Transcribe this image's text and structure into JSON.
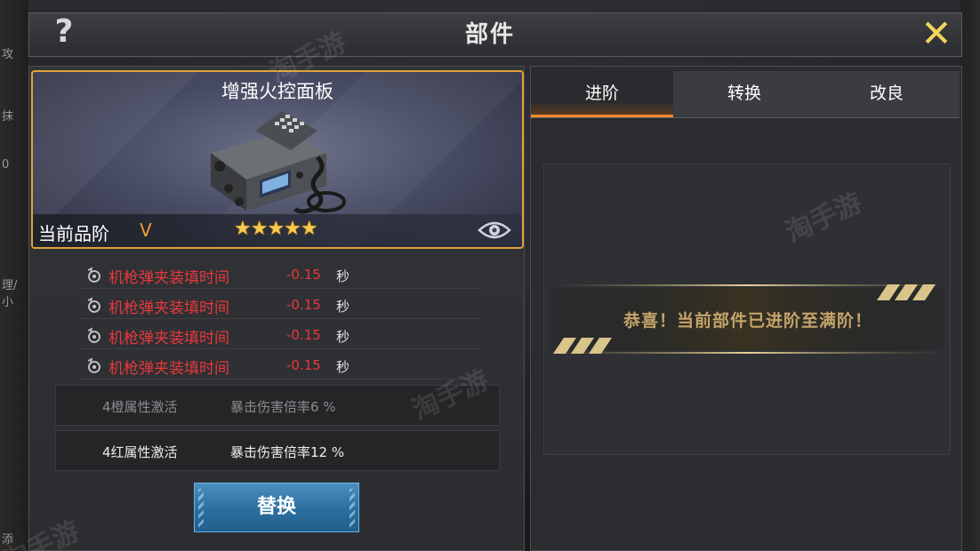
{
  "header": {
    "title": "部件",
    "help_icon": "question-mark-icon",
    "close_icon": "close-x-icon"
  },
  "background_fragments": [
    "攻",
    "抹",
    "0",
    "理/小",
    "添"
  ],
  "item": {
    "name": "增强火控面板",
    "grade_label": "当前品阶",
    "grade_value": "V",
    "stars": "★★★★★",
    "star_count": 5,
    "preview_icon": "eye-icon"
  },
  "stats": [
    {
      "name": "机枪弹夹装填时间",
      "value": "-0.15",
      "unit": "秒"
    },
    {
      "name": "机枪弹夹装填时间",
      "value": "-0.15",
      "unit": "秒"
    },
    {
      "name": "机枪弹夹装填时间",
      "value": "-0.15",
      "unit": "秒"
    },
    {
      "name": "机枪弹夹装填时间",
      "value": "-0.15",
      "unit": "秒"
    }
  ],
  "set_bonuses": [
    {
      "name": "4橙属性激活",
      "effect": "暴击伤害倍率6 %",
      "active": false
    },
    {
      "name": "4红属性激活",
      "effect": "暴击伤害倍率12 %",
      "active": true
    }
  ],
  "replace_button": "替换",
  "tabs": [
    {
      "label": "进阶",
      "active": true
    },
    {
      "label": "转换",
      "active": false
    },
    {
      "label": "改良",
      "active": false
    }
  ],
  "max_message": "恭喜！当前部件已进阶至满阶！",
  "colors": {
    "accent_orange": "#f08a30",
    "frame_gold": "#e0a23a",
    "stat_red": "#e8383c",
    "button_blue": "#2a6fa0",
    "close_yellow": "#f4d35e",
    "banner_gold": "#c4a46a"
  }
}
